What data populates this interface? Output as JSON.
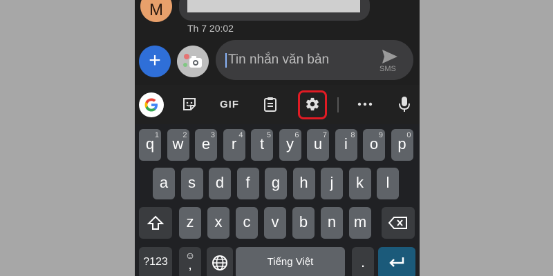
{
  "chat": {
    "avatar_letter": "M",
    "timestamp": "Th 7 20:02"
  },
  "compose": {
    "placeholder": "Tin nhắn văn bản",
    "send_label": "SMS"
  },
  "toolbar": {
    "gif_label": "GIF"
  },
  "keyboard": {
    "row1": [
      {
        "key": "q",
        "hint": "1"
      },
      {
        "key": "w",
        "hint": "2"
      },
      {
        "key": "e",
        "hint": "3"
      },
      {
        "key": "r",
        "hint": "4"
      },
      {
        "key": "t",
        "hint": "5"
      },
      {
        "key": "y",
        "hint": "6"
      },
      {
        "key": "u",
        "hint": "7"
      },
      {
        "key": "i",
        "hint": "8"
      },
      {
        "key": "o",
        "hint": "9"
      },
      {
        "key": "p",
        "hint": "0"
      }
    ],
    "row2": [
      "a",
      "s",
      "d",
      "f",
      "g",
      "h",
      "j",
      "k",
      "l"
    ],
    "row3": [
      "z",
      "x",
      "c",
      "v",
      "b",
      "n",
      "m"
    ],
    "symbols_label": "?123",
    "comma_label": ",",
    "emoji_hint": "☺",
    "space_label": "Tiếng Việt",
    "period_label": "."
  }
}
